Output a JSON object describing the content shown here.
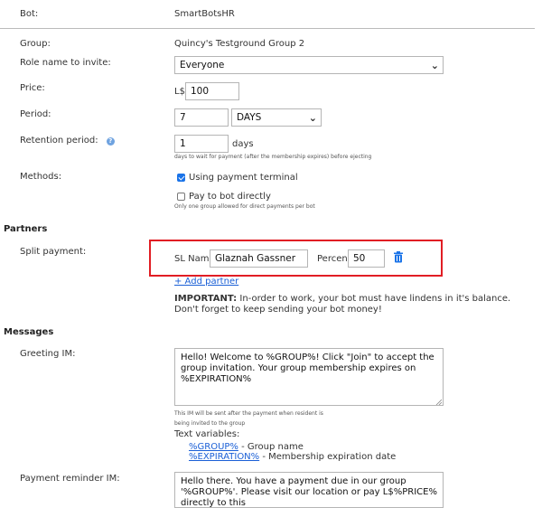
{
  "bot": {
    "label": "Bot:",
    "value": "SmartBotsHR"
  },
  "group": {
    "label": "Group:",
    "value": "Quincy's Testground Group 2"
  },
  "role": {
    "label": "Role name to invite:",
    "selected": "Everyone"
  },
  "price": {
    "label": "Price:",
    "currency": "L$",
    "value": "100"
  },
  "period": {
    "label": "Period:",
    "value": "7",
    "unit": "DAYS"
  },
  "retention": {
    "label": "Retention period:",
    "value": "1",
    "unit": "days",
    "hint": "days to wait for payment (after the membership expires) before ejecting"
  },
  "methods": {
    "label": "Methods:",
    "terminal_label": "Using payment terminal",
    "terminal_checked": true,
    "direct_label": "Pay to bot directly",
    "direct_checked": false,
    "direct_hint": "Only one group allowed for direct payments per bot"
  },
  "partners": {
    "section_title": "Partners",
    "split_label": "Split payment:",
    "sl_name_label": "SL Name",
    "sl_name_value": "Glaznah Gassner",
    "percent_label": "Percent",
    "percent_value": "50",
    "add_partner": "+ Add partner",
    "important_bold": "IMPORTANT:",
    "important_text": " In-order to work, your bot must have lindens in it's balance.",
    "important_line2": "Don't forget to keep sending your bot money!"
  },
  "messages": {
    "section_title": "Messages",
    "greeting_label": "Greeting IM:",
    "greeting_text": "Hello! Welcome to %GROUP%! Click \"Join\" to accept the group invitation. Your group membership expires on %EXPIRATION%",
    "greeting_hint1": "This IM will be sent after the payment when resident is",
    "greeting_hint2": "being invited to the group",
    "text_variables_label": "Text variables:",
    "var1_name": "%GROUP%",
    "var1_desc": " - Group name",
    "var2_name": "%EXPIRATION%",
    "var2_desc": " - Membership expiration date",
    "reminder_label": "Payment reminder IM:",
    "reminder_text": "Hello there. You have a payment due in our group '%GROUP%'. Please visit our location or pay L$%PRICE% directly to this"
  }
}
